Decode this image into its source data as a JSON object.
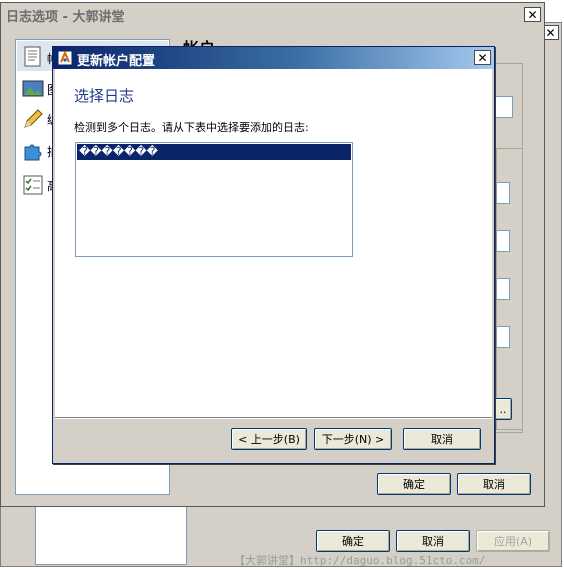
{
  "back_window": {},
  "options_window": {
    "title": "日志选项 - 大郭讲堂",
    "nav_items": [
      {
        "label": "帐",
        "icon": "document-icon"
      },
      {
        "label": "图",
        "icon": "picture-icon"
      },
      {
        "label": "编",
        "icon": "pencil-icon"
      },
      {
        "label": "插",
        "icon": "puzzle-icon"
      },
      {
        "label": "高",
        "icon": "checklist-icon"
      }
    ],
    "section_heading": "帐户",
    "ok_label": "确定",
    "cancel_label": "取消"
  },
  "back_buttons": {
    "ok_label": "确定",
    "cancel_label": "取消",
    "apply_label": "应用(A)"
  },
  "dialog": {
    "title": "更新帐户配置",
    "heading": "选择日志",
    "instruction": "检测到多个日志。请从下表中选择要添加的日志:",
    "blogs": [
      "�������"
    ],
    "selected_index": 0,
    "back_label": "< 上一步(B)",
    "next_label": "下一步(N) >",
    "cancel_label": "取消"
  },
  "watermark": "【大郭讲堂】http://daguo.blog.51cto.com/"
}
